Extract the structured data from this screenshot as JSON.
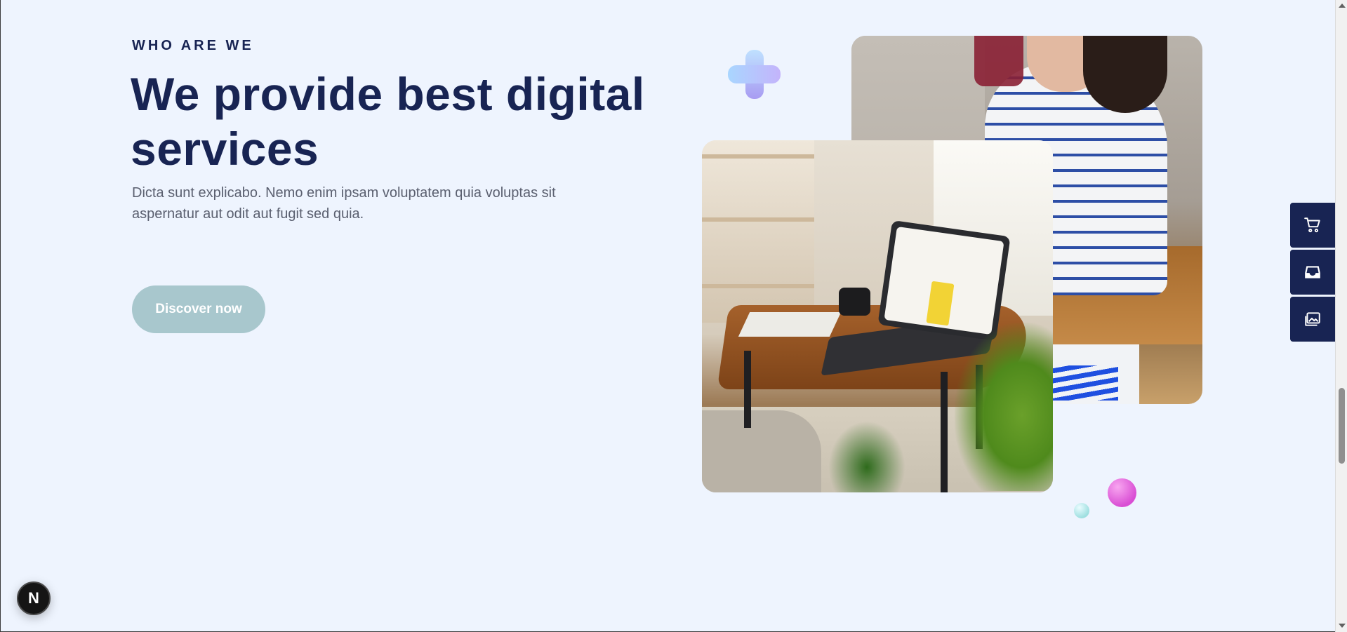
{
  "about": {
    "eyebrow": "WHO ARE WE",
    "headline": "We provide best digital services",
    "description": "Dicta sunt explicabo. Nemo enim ipsam voluptatem quia voluptas sit aspernatur aut odit aut fugit sed quia.",
    "cta_label": "Discover now"
  },
  "images": {
    "primary": "woman-drinking-photo",
    "secondary": "laptop-on-table-photo"
  },
  "side_actions": [
    {
      "icon": "cart-icon"
    },
    {
      "icon": "inbox-icon"
    },
    {
      "icon": "gallery-icon"
    }
  ],
  "dev_badge": {
    "label": "N"
  },
  "colors": {
    "background": "#eef4fe",
    "navy": "#182453",
    "cta": "#a8c7cd",
    "body_text": "#5b6070"
  }
}
